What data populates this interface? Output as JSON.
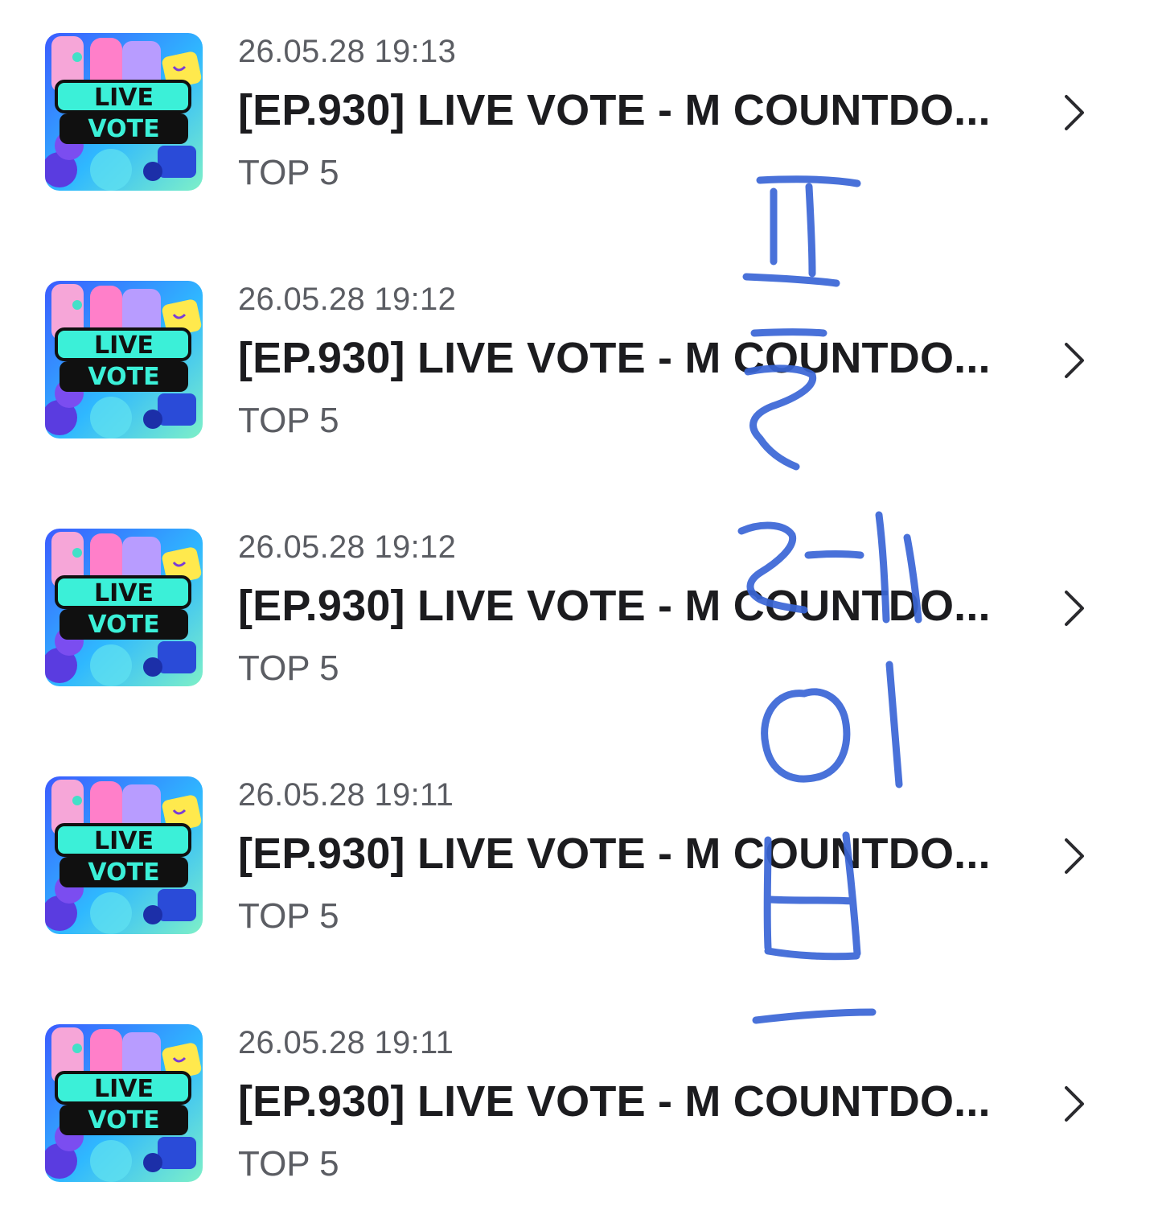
{
  "items": [
    {
      "date": "26.05.28 19:13",
      "title": "[EP.930] LIVE VOTE - M COUNTDO...",
      "subtitle": "TOP 5",
      "thumbnail_text": [
        "LIVE",
        "VOTE"
      ]
    },
    {
      "date": "26.05.28 19:12",
      "title": "[EP.930] LIVE VOTE - M COUNTDO...",
      "subtitle": "TOP 5",
      "thumbnail_text": [
        "LIVE",
        "VOTE"
      ]
    },
    {
      "date": "26.05.28 19:12",
      "title": "[EP.930] LIVE VOTE - M COUNTDO...",
      "subtitle": "TOP 5",
      "thumbnail_text": [
        "LIVE",
        "VOTE"
      ]
    },
    {
      "date": "26.05.28 19:11",
      "title": "[EP.930] LIVE VOTE - M COUNTDO...",
      "subtitle": "TOP 5",
      "thumbnail_text": [
        "LIVE",
        "VOTE"
      ]
    },
    {
      "date": "26.05.28 19:11",
      "title": "[EP.930] LIVE VOTE - M COUNTDO...",
      "subtitle": "TOP 5",
      "thumbnail_text": [
        "LIVE",
        "VOTE"
      ]
    }
  ],
  "icons": {
    "row_arrow": "chevron-right-icon"
  },
  "colors": {
    "handwriting": "#3a66d6",
    "title": "#1c1c1f",
    "meta": "#5b5d63"
  }
}
